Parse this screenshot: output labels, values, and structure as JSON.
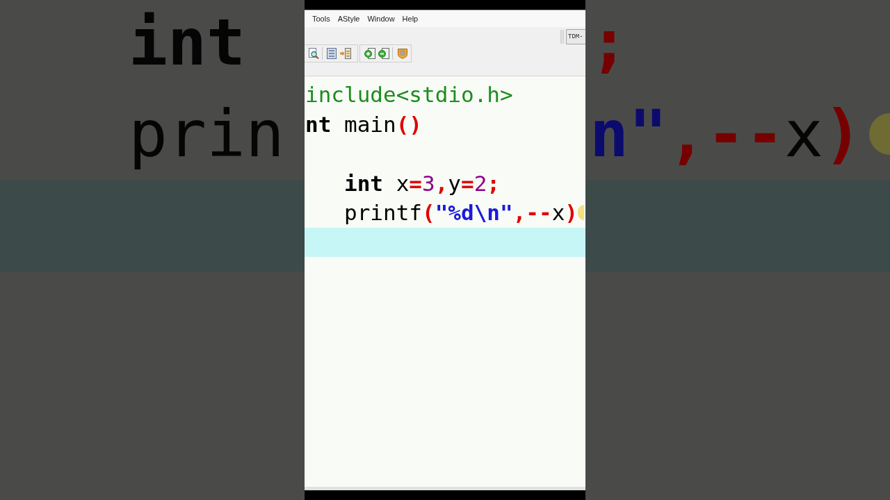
{
  "menu": [
    {
      "label": "Tools"
    },
    {
      "label": "AStyle"
    },
    {
      "label": "Window"
    },
    {
      "label": "Help"
    }
  ],
  "toolbar": {
    "dropdown": {
      "value": "TDM-"
    }
  },
  "editor": {
    "lines": [
      {
        "current": false,
        "indented": false,
        "pointer_highlight": false,
        "tokens": [
          {
            "text": "include<stdio.h>",
            "kind": "preprocessor"
          }
        ]
      },
      {
        "current": false,
        "indented": false,
        "pointer_highlight": false,
        "tokens": [
          {
            "text": "nt",
            "kind": "keyword"
          },
          {
            "text": " main",
            "kind": "plain"
          },
          {
            "text": "()",
            "kind": "symbol"
          }
        ]
      },
      {
        "current": false
      },
      {
        "current": false,
        "indented": true,
        "pointer_highlight": false,
        "tokens": [
          {
            "text": "int",
            "kind": "keyword"
          },
          {
            "text": " x",
            "kind": "plain"
          },
          {
            "text": "=",
            "kind": "symbol"
          },
          {
            "text": "3",
            "kind": "number"
          },
          {
            "text": ",",
            "kind": "symbol"
          },
          {
            "text": "y",
            "kind": "plain"
          },
          {
            "text": "=",
            "kind": "symbol"
          },
          {
            "text": "2",
            "kind": "number"
          },
          {
            "text": ";",
            "kind": "symbol"
          }
        ]
      },
      {
        "current": false,
        "indented": true,
        "pointer_highlight": true,
        "tokens": [
          {
            "text": "printf",
            "kind": "plain"
          },
          {
            "text": "(",
            "kind": "symbol"
          },
          {
            "text": "\"%d\\n\"",
            "kind": "string"
          },
          {
            "text": ",--",
            "kind": "symbol"
          },
          {
            "text": "x",
            "kind": "plain"
          },
          {
            "text": ")",
            "kind": "symbol"
          }
        ]
      },
      {
        "current": true
      }
    ]
  },
  "backdrop": {
    "left_lines": [
      {
        "current": false,
        "pointer_highlight": false,
        "tokens": [
          {
            "text": "int",
            "kind": "keyword"
          }
        ]
      },
      {
        "current": false,
        "pointer_highlight": false,
        "tokens": [
          {
            "text": "prin",
            "kind": "plain"
          }
        ]
      },
      {
        "current": true
      }
    ],
    "right_lines": [
      {
        "current": false,
        "pointer_highlight": false,
        "tokens": [
          {
            "text": ";",
            "kind": "symbol"
          }
        ]
      },
      {
        "current": false,
        "pointer_highlight": true,
        "tokens": [
          {
            "text": "n\"",
            "kind": "string"
          },
          {
            "text": ",--",
            "kind": "symbol"
          },
          {
            "text": "x",
            "kind": "plain"
          },
          {
            "text": ")",
            "kind": "symbol"
          }
        ]
      },
      {
        "current": true
      }
    ]
  }
}
